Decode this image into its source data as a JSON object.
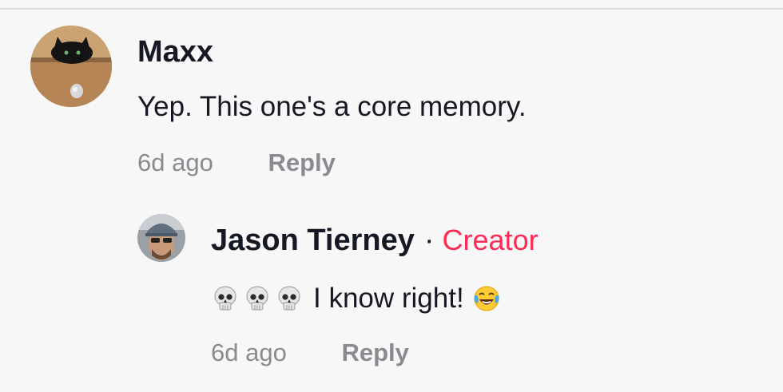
{
  "comments": [
    {
      "author": "Maxx",
      "text": "Yep. This one's a core memory.",
      "time": "6d ago",
      "reply_label": "Reply"
    },
    {
      "author": "Jason Tierney",
      "separator": "·",
      "badge": "Creator",
      "text": "I know right!",
      "emoji_prefix": [
        "skull-emoji",
        "skull-emoji",
        "skull-emoji"
      ],
      "emoji_suffix": "laughing-tears-emoji",
      "time": "6d ago",
      "reply_label": "Reply"
    }
  ],
  "colors": {
    "background": "#f7f7f7",
    "text": "#161823",
    "muted": "#8a8b91",
    "creator": "#fe2c55"
  }
}
